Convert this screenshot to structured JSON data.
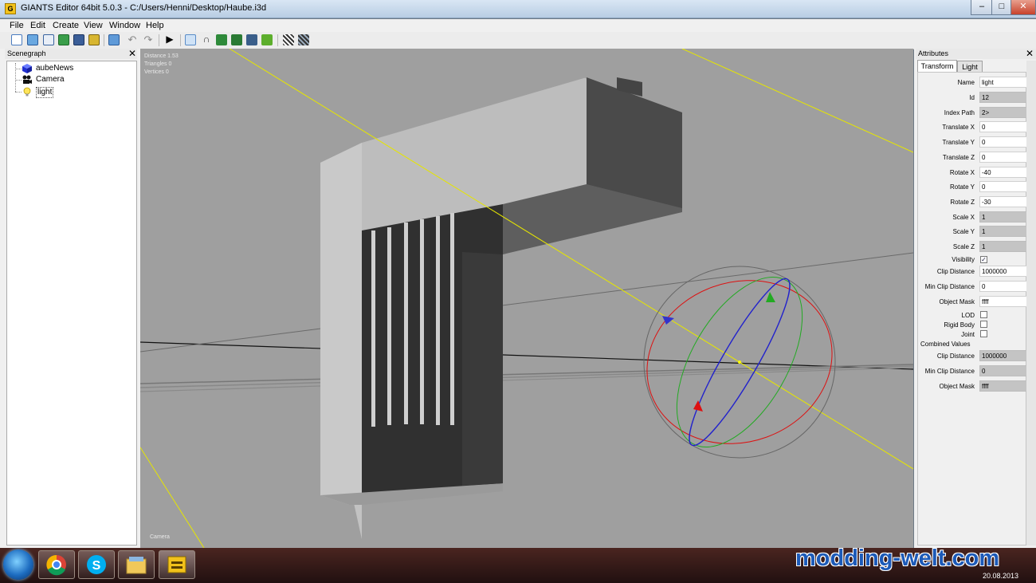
{
  "window": {
    "title": "GIANTS Editor 64bit 5.0.3 - C:/Users/Henni/Desktop/Haube.i3d",
    "controls": {
      "minimize": "–",
      "maximize": "□",
      "close": "✕"
    }
  },
  "menu": [
    "File",
    "Edit",
    "Create",
    "View",
    "Window",
    "Help"
  ],
  "toolbar": {
    "icons": [
      "new-icon",
      "open-icon",
      "import-icon",
      "reload-icon",
      "save-icon",
      "save-all-icon",
      "export-icon",
      "undo-icon",
      "redo-icon",
      "play-icon",
      "select-icon",
      "move-icon",
      "terrain-sculpt-icon",
      "terrain-paint-icon",
      "foliage-paint-icon",
      "foliage-icon",
      "checker-icon",
      "checker-edit-icon"
    ]
  },
  "scenegraph": {
    "title": "Scenegraph",
    "close": "✕",
    "nodes": [
      {
        "label": "aubeNews",
        "icon": "cube-icon"
      },
      {
        "label": "Camera",
        "icon": "camera-icon"
      },
      {
        "label": "light",
        "icon": "lightbulb-icon",
        "selected": true
      }
    ]
  },
  "viewport": {
    "stats": [
      "Distance 1.53",
      "Triangles 0",
      "Vertices 0"
    ],
    "camera_label": "Camera"
  },
  "attributes": {
    "title": "Attributes",
    "close": "✕",
    "tabs": [
      "Transform",
      "Light"
    ],
    "fields": [
      {
        "label": "Name",
        "value": "light"
      },
      {
        "label": "Id",
        "value": "12"
      },
      {
        "label": "Index Path",
        "value": "2>"
      },
      {
        "label": "Translate X",
        "value": "0"
      },
      {
        "label": "Translate Y",
        "value": "0"
      },
      {
        "label": "Translate Z",
        "value": "0"
      },
      {
        "label": "Rotate X",
        "value": "-40"
      },
      {
        "label": "Rotate Y",
        "value": "0"
      },
      {
        "label": "Rotate Z",
        "value": "-30"
      },
      {
        "label": "Scale X",
        "value": "1"
      },
      {
        "label": "Scale Y",
        "value": "1"
      },
      {
        "label": "Scale Z",
        "value": "1"
      },
      {
        "label": "Visibility",
        "checked": true
      },
      {
        "label": "Clip Distance",
        "value": "1000000"
      },
      {
        "label": "Min Clip Distance",
        "value": "0"
      },
      {
        "label": "Object Mask",
        "value": "ffff"
      },
      {
        "label": "LOD",
        "checked": false
      },
      {
        "label": "Rigid Body",
        "checked": false
      },
      {
        "label": "Joint",
        "checked": false
      }
    ],
    "combined_title": "Combined Values",
    "combined": [
      {
        "label": "Clip Distance",
        "value": "1000000"
      },
      {
        "label": "Min Clip Distance",
        "value": "0"
      },
      {
        "label": "Object Mask",
        "value": "ffff"
      }
    ]
  },
  "taskbar": {
    "apps": [
      "chrome-icon",
      "skype-icon",
      "explorer-icon",
      "giants-editor-icon"
    ],
    "watermark": "modding-welt.com",
    "date": "20.08.2013"
  },
  "colors": {
    "viewport_bg": "#9f9f9f",
    "gizmo_x": "#d11",
    "gizmo_y": "#2a2",
    "gizmo_z": "#22c",
    "light_dir": "#e6e600"
  }
}
